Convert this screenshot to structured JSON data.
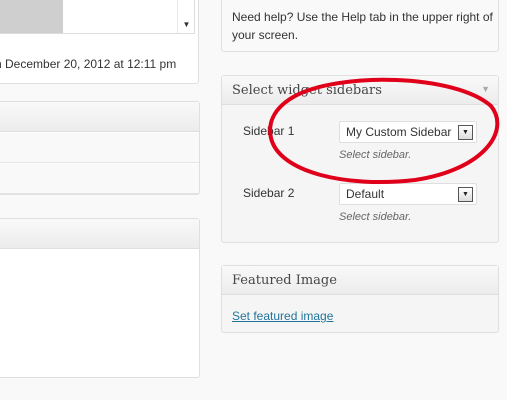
{
  "left": {
    "last_edited": "n December 20, 2012 at 12:11 pm",
    "scroll_icon": "arrow-down-icon"
  },
  "help": {
    "text": "Need help? Use the Help tab in the upper right of your screen."
  },
  "sidebars_panel": {
    "title": "Select widget sidebars",
    "toggle_icon": "triangle-down-icon",
    "sidebar1": {
      "label": "Sidebar 1",
      "selected": "My Custom Sidebar",
      "description": "Select sidebar."
    },
    "sidebar2": {
      "label": "Sidebar 2",
      "selected": "Default",
      "description": "Select sidebar."
    }
  },
  "featured_panel": {
    "title": "Featured Image",
    "link": "Set featured image"
  },
  "colors": {
    "annotation": "#e0001a",
    "link": "#21759b"
  }
}
